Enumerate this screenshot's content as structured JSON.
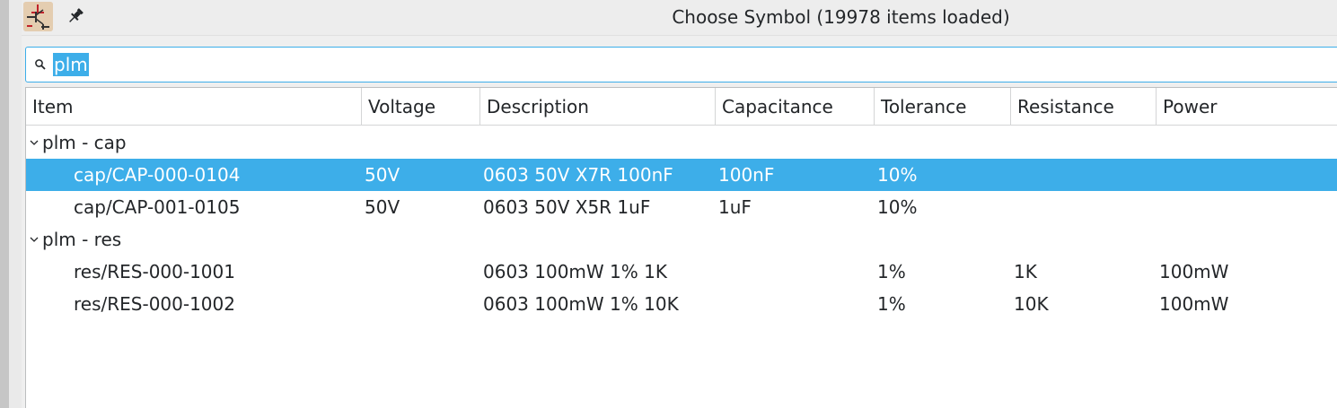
{
  "window": {
    "title": "Choose Symbol (19978 items loaded)",
    "app_icon": "kicad-eeschema-icon",
    "pin_icon": "pin-icon"
  },
  "search": {
    "value": "plm",
    "icon": "search-icon"
  },
  "table": {
    "columns": [
      "Item",
      "Voltage",
      "Description",
      "Capacitance",
      "Tolerance",
      "Resistance",
      "Power"
    ],
    "groups": [
      {
        "label": "plm - cap",
        "rows": [
          {
            "item": "cap/CAP-000-0104",
            "voltage": "50V",
            "description": "0603 50V X7R 100nF",
            "capacitance": "100nF",
            "tolerance": "10%",
            "resistance": "",
            "power": "",
            "selected": true
          },
          {
            "item": "cap/CAP-001-0105",
            "voltage": "50V",
            "description": "0603 50V X5R 1uF",
            "capacitance": "1uF",
            "tolerance": "10%",
            "resistance": "",
            "power": "",
            "selected": false
          }
        ]
      },
      {
        "label": "plm - res",
        "rows": [
          {
            "item": "res/RES-000-1001",
            "voltage": "",
            "description": "0603 100mW 1% 1K",
            "capacitance": "",
            "tolerance": "1%",
            "resistance": "1K",
            "power": "100mW",
            "selected": false
          },
          {
            "item": "res/RES-000-1002",
            "voltage": "",
            "description": "0603 100mW 1% 10K",
            "capacitance": "",
            "tolerance": "1%",
            "resistance": "10K",
            "power": "100mW",
            "selected": false
          }
        ]
      }
    ]
  },
  "colors": {
    "selection": "#3daee9",
    "text": "#232629",
    "background": "#efefef"
  }
}
